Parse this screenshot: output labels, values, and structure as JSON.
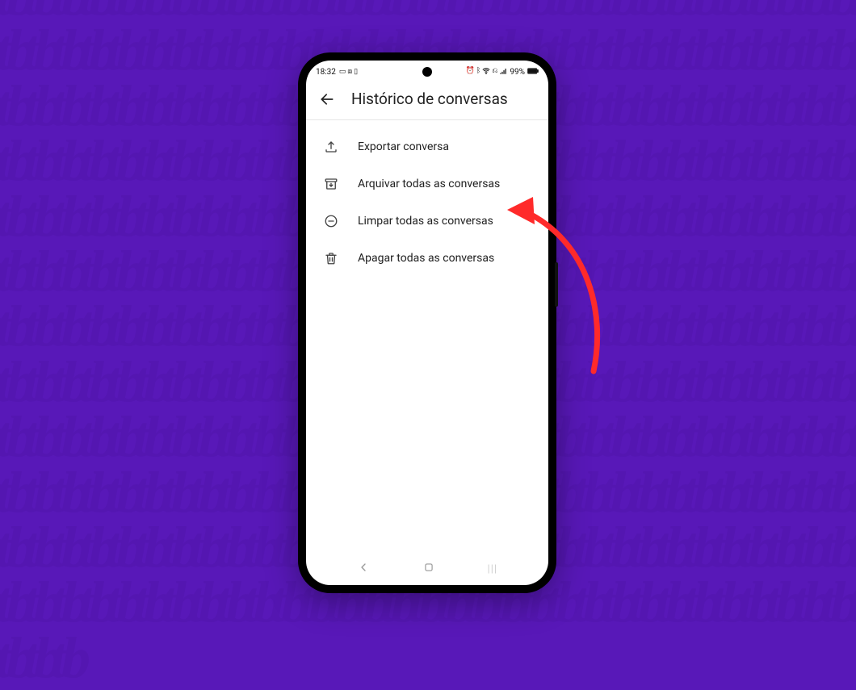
{
  "status": {
    "time": "18:32",
    "battery_text": "99%"
  },
  "header": {
    "title": "Histórico de conversas"
  },
  "menu": {
    "items": [
      {
        "id": "export",
        "label": "Exportar conversa"
      },
      {
        "id": "archive",
        "label": "Arquivar todas as conversas"
      },
      {
        "id": "clear",
        "label": "Limpar todas as conversas"
      },
      {
        "id": "delete",
        "label": "Apagar todas as conversas"
      }
    ]
  },
  "annotation": {
    "target_item_index": 2,
    "color": "#ff2a2a"
  }
}
